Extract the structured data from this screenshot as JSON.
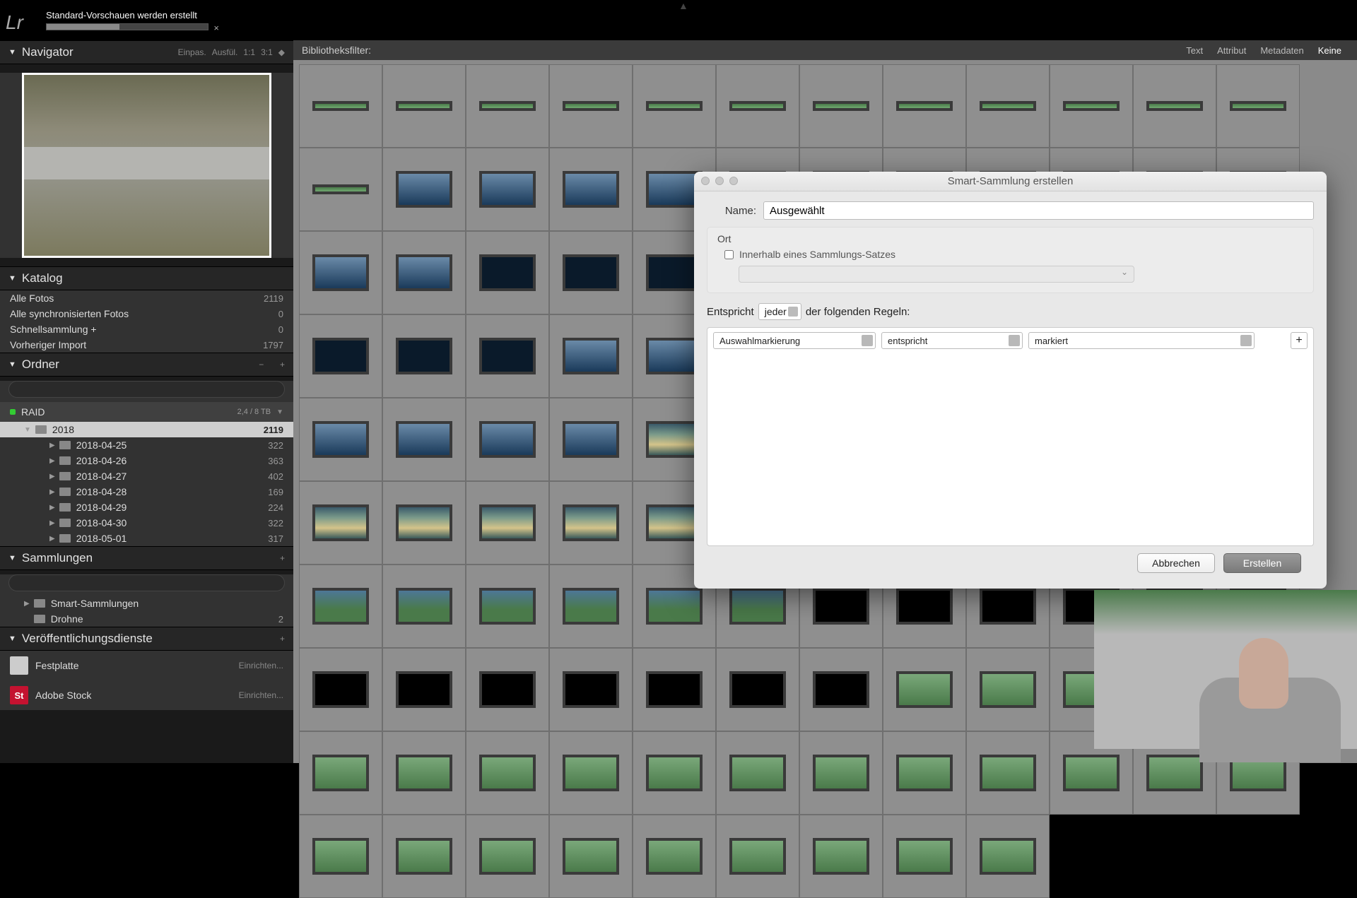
{
  "topbar": {
    "logo": "Lr",
    "progress_text": "Standard-Vorschauen werden erstellt",
    "close": "×"
  },
  "panels": {
    "navigator": {
      "title": "Navigator",
      "tools": [
        "Einpas.",
        "Ausfül.",
        "1:1",
        "3:1"
      ]
    },
    "catalog": {
      "title": "Katalog",
      "items": [
        {
          "label": "Alle Fotos",
          "count": "2119"
        },
        {
          "label": "Alle synchronisierten Fotos",
          "count": "0"
        },
        {
          "label": "Schnellsammlung  +",
          "count": "0"
        },
        {
          "label": "Vorheriger Import",
          "count": "1797"
        }
      ]
    },
    "folders": {
      "title": "Ordner",
      "volume": {
        "name": "RAID",
        "stat": "2,4 / 8 TB"
      },
      "root": {
        "name": "2018",
        "count": "2119"
      },
      "dates": [
        {
          "name": "2018-04-25",
          "count": "322"
        },
        {
          "name": "2018-04-26",
          "count": "363"
        },
        {
          "name": "2018-04-27",
          "count": "402"
        },
        {
          "name": "2018-04-28",
          "count": "169"
        },
        {
          "name": "2018-04-29",
          "count": "224"
        },
        {
          "name": "2018-04-30",
          "count": "322"
        },
        {
          "name": "2018-05-01",
          "count": "317"
        }
      ]
    },
    "collections": {
      "title": "Sammlungen",
      "items": [
        {
          "label": "Smart-Sammlungen",
          "count": ""
        },
        {
          "label": "Drohne",
          "count": "2"
        }
      ]
    },
    "publish": {
      "title": "Veröffentlichungsdienste",
      "services": [
        {
          "label": "Festplatte",
          "setup": "Einrichten..."
        },
        {
          "label": "Adobe Stock",
          "setup": "Einrichten...",
          "badge": "St"
        }
      ]
    }
  },
  "filterbar": {
    "label": "Bibliotheksfilter:",
    "opts": [
      "Text",
      "Attribut",
      "Metadaten",
      "Keine"
    ]
  },
  "dialog": {
    "title": "Smart-Sammlung erstellen",
    "name_label": "Name:",
    "name_value": "Ausgewählt",
    "location_label": "Ort",
    "inside_set": "Innerhalb eines Sammlungs-Satzes",
    "match_pre": "Entspricht",
    "match_mode": "jeder",
    "match_post": "der folgenden Regeln:",
    "rule": {
      "field": "Auswahlmarkierung",
      "op": "entspricht",
      "value": "markiert",
      "add": "+"
    },
    "cancel": "Abbrechen",
    "create": "Erstellen"
  }
}
